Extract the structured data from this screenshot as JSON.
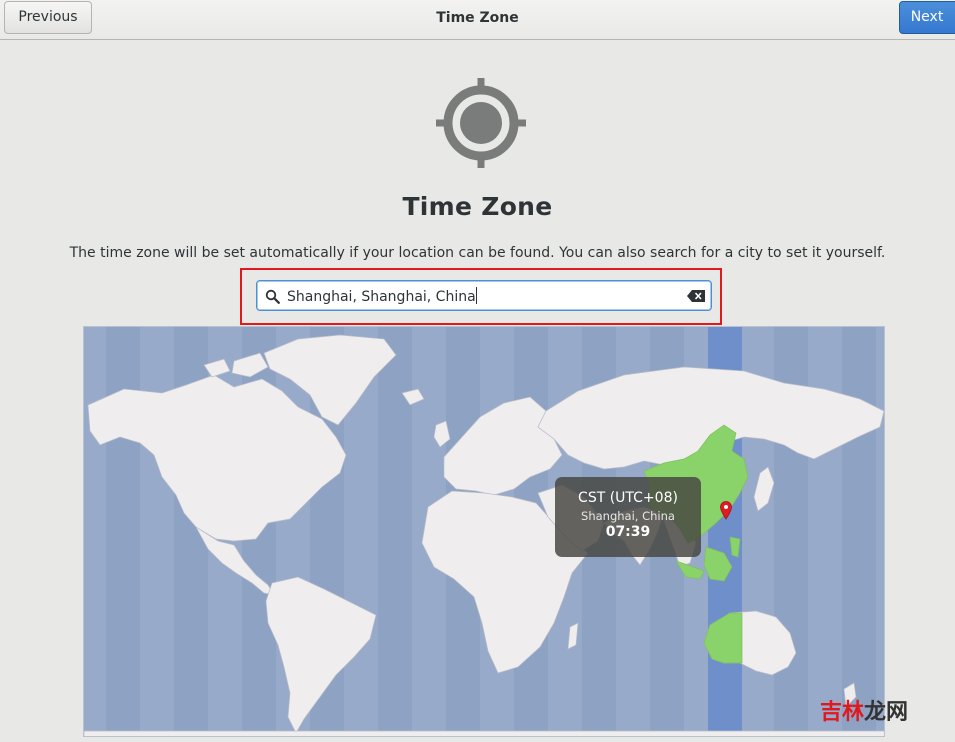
{
  "header": {
    "title": "Time Zone",
    "previous_label": "Previous",
    "next_label": "Next"
  },
  "page": {
    "icon": "location-target-icon",
    "title": "Time Zone",
    "description": "The time zone will be set automatically if your location can be found. You can also search for a city to set it yourself."
  },
  "search": {
    "value": "Shanghai, Shanghai, China",
    "icons": [
      "search-icon",
      "clear-text-icon"
    ]
  },
  "map": {
    "tooltip": {
      "zone": "CST (UTC+08)",
      "city": "Shanghai, China",
      "time": "07:39"
    },
    "colors": {
      "ocean": "#98aac9",
      "land": "#efedee",
      "selected_zone_land": "#8ad26a",
      "selected_zone_band": "#6e8fc9",
      "marker": "#e01b24"
    }
  },
  "watermark": {
    "text_red": "吉林",
    "text_dark": "龙网"
  },
  "colors": {
    "accent": "#3a7fd5",
    "highlight_border": "#e0191f"
  }
}
